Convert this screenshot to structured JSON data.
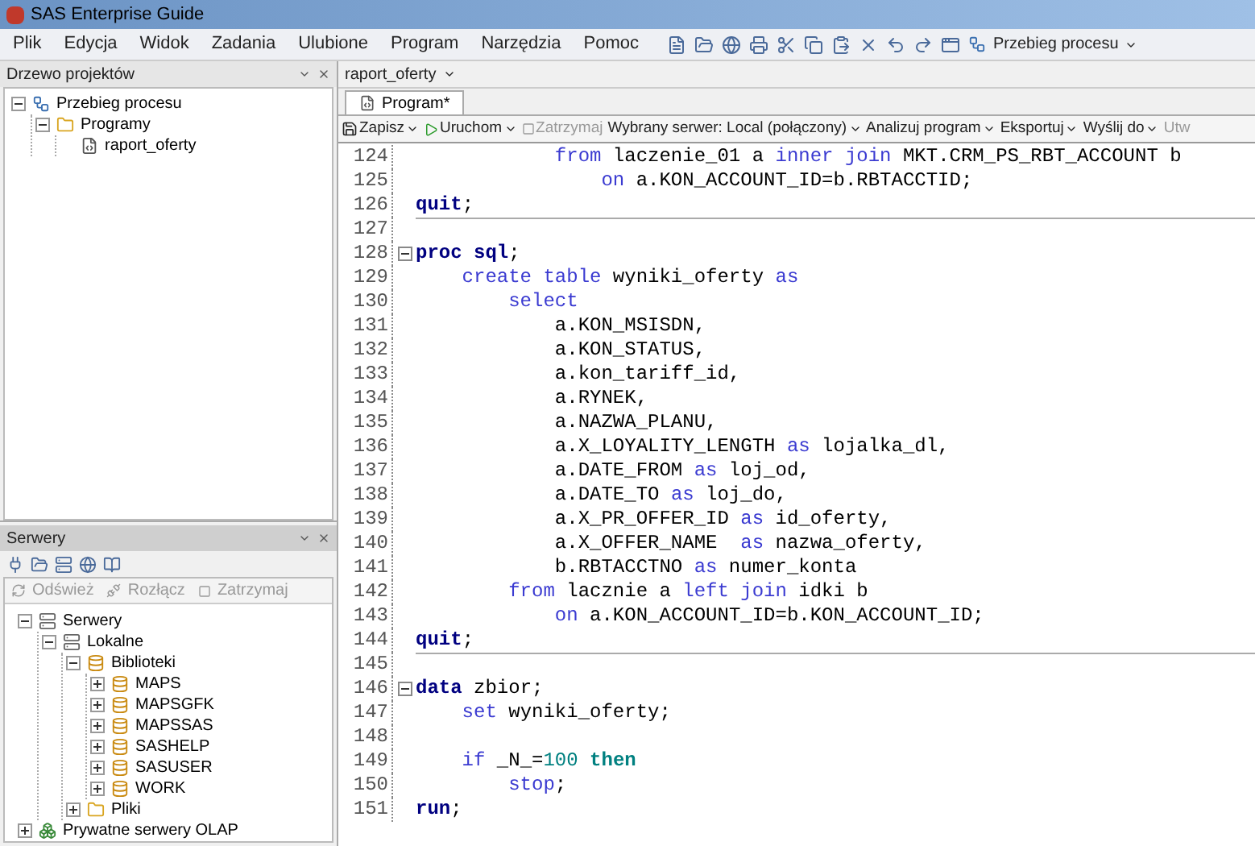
{
  "window": {
    "title": "SAS Enterprise Guide"
  },
  "menu": [
    "Plik",
    "Edycja",
    "Widok",
    "Zadania",
    "Ulubione",
    "Program",
    "Narzędzia",
    "Pomoc"
  ],
  "toolbar": {
    "flow_button": "Przebieg procesu"
  },
  "project_panel": {
    "title": "Drzewo projektów",
    "tree": [
      {
        "label": "Przebieg procesu",
        "kind": "flow",
        "expanded": true,
        "children": [
          {
            "label": "Programy",
            "kind": "folder",
            "expanded": true,
            "children": [
              {
                "label": "raport_oferty",
                "kind": "program"
              }
            ]
          }
        ]
      }
    ]
  },
  "servers_panel": {
    "title": "Serwery",
    "actions": [
      {
        "label": "Odśwież",
        "disabled": true
      },
      {
        "label": "Rozłącz",
        "disabled": true
      },
      {
        "label": "Zatrzymaj",
        "disabled": true
      }
    ],
    "tree": [
      {
        "label": "Serwery",
        "kind": "server",
        "expanded": true,
        "children": [
          {
            "label": "Lokalne",
            "kind": "server",
            "expanded": true,
            "children": [
              {
                "label": "Biblioteki",
                "kind": "library",
                "expanded": true,
                "children": [
                  {
                    "label": "MAPS",
                    "kind": "library",
                    "expanded": false
                  },
                  {
                    "label": "MAPSGFK",
                    "kind": "library",
                    "expanded": false
                  },
                  {
                    "label": "MAPSSAS",
                    "kind": "library",
                    "expanded": false
                  },
                  {
                    "label": "SASHELP",
                    "kind": "library",
                    "expanded": false
                  },
                  {
                    "label": "SASUSER",
                    "kind": "library",
                    "expanded": false
                  },
                  {
                    "label": "WORK",
                    "kind": "library",
                    "expanded": false
                  }
                ]
              },
              {
                "label": "Pliki",
                "kind": "folder",
                "expanded": false
              }
            ]
          }
        ]
      },
      {
        "label": "Prywatne serwery OLAP",
        "kind": "olap",
        "expanded": false
      }
    ]
  },
  "document": {
    "title": "raport_oferty",
    "tabs": [
      {
        "label": "Program*",
        "selected": true
      }
    ],
    "toolbar": [
      {
        "label": "Zapisz",
        "dropdown": true,
        "disabled": false
      },
      {
        "label": "Uruchom",
        "dropdown": true,
        "disabled": false
      },
      {
        "label": "Zatrzymaj",
        "dropdown": false,
        "disabled": true
      },
      {
        "label": "Wybrany serwer: Local (połączony)",
        "dropdown": true,
        "disabled": false
      },
      {
        "label": "Analizuj program",
        "dropdown": true,
        "disabled": false
      },
      {
        "label": "Eksportuj",
        "dropdown": true,
        "disabled": false
      },
      {
        "label": "Wyślij do",
        "dropdown": true,
        "disabled": false
      },
      {
        "label": "Utw",
        "dropdown": false,
        "disabled": true
      }
    ]
  },
  "code": [
    {
      "number": "124",
      "tokens": [
        {
          "kind": "kw",
          "text": "            from"
        },
        {
          "kind": "plain",
          "text": " laczenie_01 a "
        },
        {
          "kind": "kw",
          "text": "inner join"
        },
        {
          "kind": "plain",
          "text": " MKT.CRM_PS_RBT_ACCOUNT b"
        }
      ]
    },
    {
      "number": "125",
      "tokens": [
        {
          "kind": "kw",
          "text": "                on"
        },
        {
          "kind": "plain",
          "text": " a.KON_ACCOUNT_ID=b.RBTACCTID;"
        }
      ]
    },
    {
      "number": "126",
      "rule": true,
      "tokens": [
        {
          "kind": "step",
          "text": "quit"
        },
        {
          "kind": "plain",
          "text": ";"
        }
      ]
    },
    {
      "number": "127"
    },
    {
      "number": "128",
      "fold": true,
      "tokens": [
        {
          "kind": "step",
          "text": "proc sql"
        },
        {
          "kind": "plain",
          "text": ";"
        }
      ]
    },
    {
      "number": "129",
      "tokens": [
        {
          "kind": "kw",
          "text": "    create table"
        },
        {
          "kind": "plain",
          "text": " wyniki_oferty "
        },
        {
          "kind": "kw",
          "text": "as"
        }
      ]
    },
    {
      "number": "130",
      "tokens": [
        {
          "kind": "kw",
          "text": "        select"
        }
      ]
    },
    {
      "number": "131",
      "tokens": [
        {
          "kind": "plain",
          "text": "            a.KON_MSISDN,"
        }
      ]
    },
    {
      "number": "132",
      "tokens": [
        {
          "kind": "plain",
          "text": "            a.KON_STATUS,"
        }
      ]
    },
    {
      "number": "133",
      "tokens": [
        {
          "kind": "plain",
          "text": "            a.kon_tariff_id,"
        }
      ]
    },
    {
      "number": "134",
      "tokens": [
        {
          "kind": "plain",
          "text": "            a.RYNEK,"
        }
      ]
    },
    {
      "number": "135",
      "tokens": [
        {
          "kind": "plain",
          "text": "            a.NAZWA_PLANU,"
        }
      ]
    },
    {
      "number": "136",
      "tokens": [
        {
          "kind": "plain",
          "text": "            a.X_LOYALITY_LENGTH "
        },
        {
          "kind": "kw",
          "text": "as"
        },
        {
          "kind": "plain",
          "text": " lojalka_dl,"
        }
      ]
    },
    {
      "number": "137",
      "tokens": [
        {
          "kind": "plain",
          "text": "            a.DATE_FROM "
        },
        {
          "kind": "kw",
          "text": "as"
        },
        {
          "kind": "plain",
          "text": " loj_od,"
        }
      ]
    },
    {
      "number": "138",
      "tokens": [
        {
          "kind": "plain",
          "text": "            a.DATE_TO "
        },
        {
          "kind": "kw",
          "text": "as"
        },
        {
          "kind": "plain",
          "text": " loj_do,"
        }
      ]
    },
    {
      "number": "139",
      "tokens": [
        {
          "kind": "plain",
          "text": "            a.X_PR_OFFER_ID "
        },
        {
          "kind": "kw",
          "text": "as"
        },
        {
          "kind": "plain",
          "text": " id_oferty,"
        }
      ]
    },
    {
      "number": "140",
      "tokens": [
        {
          "kind": "plain",
          "text": "            a.X_OFFER_NAME  "
        },
        {
          "kind": "kw",
          "text": "as"
        },
        {
          "kind": "plain",
          "text": " nazwa_oferty,"
        }
      ]
    },
    {
      "number": "141",
      "tokens": [
        {
          "kind": "plain",
          "text": "            b.RBTACCTNO "
        },
        {
          "kind": "kw",
          "text": "as"
        },
        {
          "kind": "plain",
          "text": " numer_konta"
        }
      ]
    },
    {
      "number": "142",
      "tokens": [
        {
          "kind": "kw",
          "text": "        from"
        },
        {
          "kind": "plain",
          "text": " lacznie a "
        },
        {
          "kind": "kw",
          "text": "left join"
        },
        {
          "kind": "plain",
          "text": " idki b"
        }
      ]
    },
    {
      "number": "143",
      "tokens": [
        {
          "kind": "kw",
          "text": "            on"
        },
        {
          "kind": "plain",
          "text": " a.KON_ACCOUNT_ID=b.KON_ACCOUNT_ID;"
        }
      ]
    },
    {
      "number": "144",
      "rule": true,
      "tokens": [
        {
          "kind": "step",
          "text": "quit"
        },
        {
          "kind": "plain",
          "text": ";"
        }
      ]
    },
    {
      "number": "145"
    },
    {
      "number": "146",
      "fold": true,
      "tokens": [
        {
          "kind": "step",
          "text": "data"
        },
        {
          "kind": "plain",
          "text": " zbior;"
        }
      ]
    },
    {
      "number": "147",
      "tokens": [
        {
          "kind": "kw",
          "text": "    set"
        },
        {
          "kind": "plain",
          "text": " wyniki_oferty;"
        }
      ]
    },
    {
      "number": "148"
    },
    {
      "number": "149",
      "tokens": [
        {
          "kind": "kw",
          "text": "    if"
        },
        {
          "kind": "plain",
          "text": " _N_="
        },
        {
          "kind": "num",
          "text": "100"
        },
        {
          "kind": "cond",
          "text": " then"
        }
      ]
    },
    {
      "number": "150",
      "tokens": [
        {
          "kind": "kw",
          "text": "        stop"
        },
        {
          "kind": "plain",
          "text": ";"
        }
      ]
    },
    {
      "number": "151",
      "tokens": [
        {
          "kind": "step",
          "text": "run"
        },
        {
          "kind": "plain",
          "text": ";"
        }
      ]
    }
  ]
}
